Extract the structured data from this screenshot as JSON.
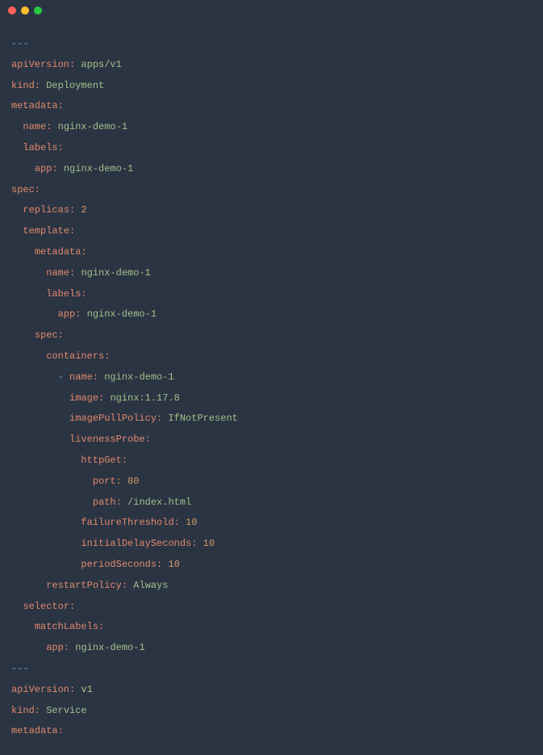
{
  "titlebar": {
    "close": "close",
    "minimize": "minimize",
    "zoom": "zoom"
  },
  "code": {
    "lines": [
      [
        {
          "t": "dash",
          "v": "---"
        }
      ],
      [
        {
          "t": "key",
          "v": "apiVersion:"
        },
        {
          "t": "plain",
          "v": " "
        },
        {
          "t": "string",
          "v": "apps/v1"
        }
      ],
      [
        {
          "t": "key",
          "v": "kind:"
        },
        {
          "t": "plain",
          "v": " "
        },
        {
          "t": "string",
          "v": "Deployment"
        }
      ],
      [
        {
          "t": "key",
          "v": "metadata:"
        }
      ],
      [
        {
          "t": "plain",
          "v": "  "
        },
        {
          "t": "key",
          "v": "name:"
        },
        {
          "t": "plain",
          "v": " "
        },
        {
          "t": "string",
          "v": "nginx-demo-1"
        }
      ],
      [
        {
          "t": "plain",
          "v": "  "
        },
        {
          "t": "key",
          "v": "labels:"
        }
      ],
      [
        {
          "t": "plain",
          "v": "    "
        },
        {
          "t": "key",
          "v": "app:"
        },
        {
          "t": "plain",
          "v": " "
        },
        {
          "t": "string",
          "v": "nginx-demo-1"
        }
      ],
      [
        {
          "t": "key",
          "v": "spec:"
        }
      ],
      [
        {
          "t": "plain",
          "v": "  "
        },
        {
          "t": "key",
          "v": "replicas:"
        },
        {
          "t": "plain",
          "v": " "
        },
        {
          "t": "number",
          "v": "2"
        }
      ],
      [
        {
          "t": "plain",
          "v": "  "
        },
        {
          "t": "key",
          "v": "template:"
        }
      ],
      [
        {
          "t": "plain",
          "v": "    "
        },
        {
          "t": "key",
          "v": "metadata:"
        }
      ],
      [
        {
          "t": "plain",
          "v": "      "
        },
        {
          "t": "key",
          "v": "name:"
        },
        {
          "t": "plain",
          "v": " "
        },
        {
          "t": "string",
          "v": "nginx-demo-1"
        }
      ],
      [
        {
          "t": "plain",
          "v": "      "
        },
        {
          "t": "key",
          "v": "labels:"
        }
      ],
      [
        {
          "t": "plain",
          "v": "        "
        },
        {
          "t": "key",
          "v": "app:"
        },
        {
          "t": "plain",
          "v": " "
        },
        {
          "t": "string",
          "v": "nginx-demo-1"
        }
      ],
      [
        {
          "t": "plain",
          "v": "    "
        },
        {
          "t": "key",
          "v": "spec:"
        }
      ],
      [
        {
          "t": "plain",
          "v": "      "
        },
        {
          "t": "key",
          "v": "containers:"
        }
      ],
      [
        {
          "t": "plain",
          "v": "        "
        },
        {
          "t": "dash",
          "v": "-"
        },
        {
          "t": "plain",
          "v": " "
        },
        {
          "t": "key",
          "v": "name:"
        },
        {
          "t": "plain",
          "v": " "
        },
        {
          "t": "string",
          "v": "nginx-demo-1"
        }
      ],
      [
        {
          "t": "plain",
          "v": "          "
        },
        {
          "t": "key",
          "v": "image:"
        },
        {
          "t": "plain",
          "v": " "
        },
        {
          "t": "string",
          "v": "nginx:1.17.8"
        }
      ],
      [
        {
          "t": "plain",
          "v": "          "
        },
        {
          "t": "key",
          "v": "imagePullPolicy:"
        },
        {
          "t": "plain",
          "v": " "
        },
        {
          "t": "string",
          "v": "IfNotPresent"
        }
      ],
      [
        {
          "t": "plain",
          "v": "          "
        },
        {
          "t": "key",
          "v": "livenessProbe:"
        }
      ],
      [
        {
          "t": "plain",
          "v": "            "
        },
        {
          "t": "key",
          "v": "httpGet:"
        }
      ],
      [
        {
          "t": "plain",
          "v": "              "
        },
        {
          "t": "key",
          "v": "port:"
        },
        {
          "t": "plain",
          "v": " "
        },
        {
          "t": "number",
          "v": "80"
        }
      ],
      [
        {
          "t": "plain",
          "v": "              "
        },
        {
          "t": "key",
          "v": "path:"
        },
        {
          "t": "plain",
          "v": " "
        },
        {
          "t": "string",
          "v": "/index.html"
        }
      ],
      [
        {
          "t": "plain",
          "v": "            "
        },
        {
          "t": "key",
          "v": "failureThreshold:"
        },
        {
          "t": "plain",
          "v": " "
        },
        {
          "t": "number",
          "v": "10"
        }
      ],
      [
        {
          "t": "plain",
          "v": "            "
        },
        {
          "t": "key",
          "v": "initialDelaySeconds:"
        },
        {
          "t": "plain",
          "v": " "
        },
        {
          "t": "number",
          "v": "10"
        }
      ],
      [
        {
          "t": "plain",
          "v": "            "
        },
        {
          "t": "key",
          "v": "periodSeconds:"
        },
        {
          "t": "plain",
          "v": " "
        },
        {
          "t": "number",
          "v": "10"
        }
      ],
      [
        {
          "t": "plain",
          "v": "      "
        },
        {
          "t": "key",
          "v": "restartPolicy:"
        },
        {
          "t": "plain",
          "v": " "
        },
        {
          "t": "string",
          "v": "Always"
        }
      ],
      [
        {
          "t": "plain",
          "v": "  "
        },
        {
          "t": "key",
          "v": "selector:"
        }
      ],
      [
        {
          "t": "plain",
          "v": "    "
        },
        {
          "t": "key",
          "v": "matchLabels:"
        }
      ],
      [
        {
          "t": "plain",
          "v": "      "
        },
        {
          "t": "key",
          "v": "app:"
        },
        {
          "t": "plain",
          "v": " "
        },
        {
          "t": "string",
          "v": "nginx-demo-1"
        }
      ],
      [
        {
          "t": "dash",
          "v": "---"
        }
      ],
      [
        {
          "t": "key",
          "v": "apiVersion:"
        },
        {
          "t": "plain",
          "v": " "
        },
        {
          "t": "string",
          "v": "v1"
        }
      ],
      [
        {
          "t": "key",
          "v": "kind:"
        },
        {
          "t": "plain",
          "v": " "
        },
        {
          "t": "string",
          "v": "Service"
        }
      ],
      [
        {
          "t": "key",
          "v": "metadata:"
        }
      ]
    ]
  }
}
